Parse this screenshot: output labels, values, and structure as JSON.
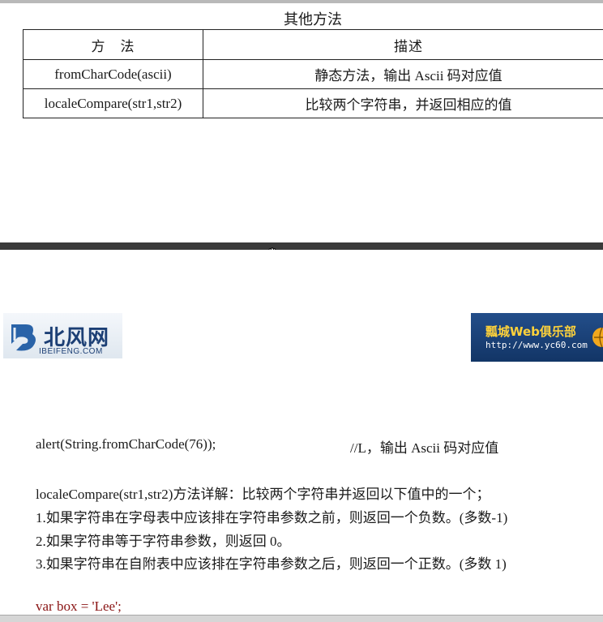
{
  "table": {
    "caption": "其他方法",
    "headers": [
      "方　法",
      "描述"
    ],
    "rows": [
      {
        "method": "fromCharCode(ascii)",
        "desc": "静态方法，输出 Ascii 码对应值"
      },
      {
        "method": "localeCompare(str1,str2)",
        "desc": "比较两个字符串，并返回相应的值"
      }
    ]
  },
  "logos": {
    "left_title": "北风网",
    "left_sub": "IBEIFENG.COM",
    "right_title": "瓢城Web俱乐部",
    "right_url": "http://www.yc60.com"
  },
  "body": {
    "code_line": "alert(String.fromCharCode(76));",
    "code_comment": "//L，输出 Ascii 码对应值",
    "explain_title": "localeCompare(str1,str2)方法详解：比较两个字符串并返回以下值中的一个；",
    "points": [
      "1.如果字符串在字母表中应该排在字符串参数之前，则返回一个负数。(多数-1)",
      "2.如果字符串等于字符串参数，则返回 0。",
      "3.如果字符串在自附表中应该排在字符串参数之后，则返回一个正数。(多数 1)"
    ],
    "code_var": "var box = 'Lee';"
  }
}
